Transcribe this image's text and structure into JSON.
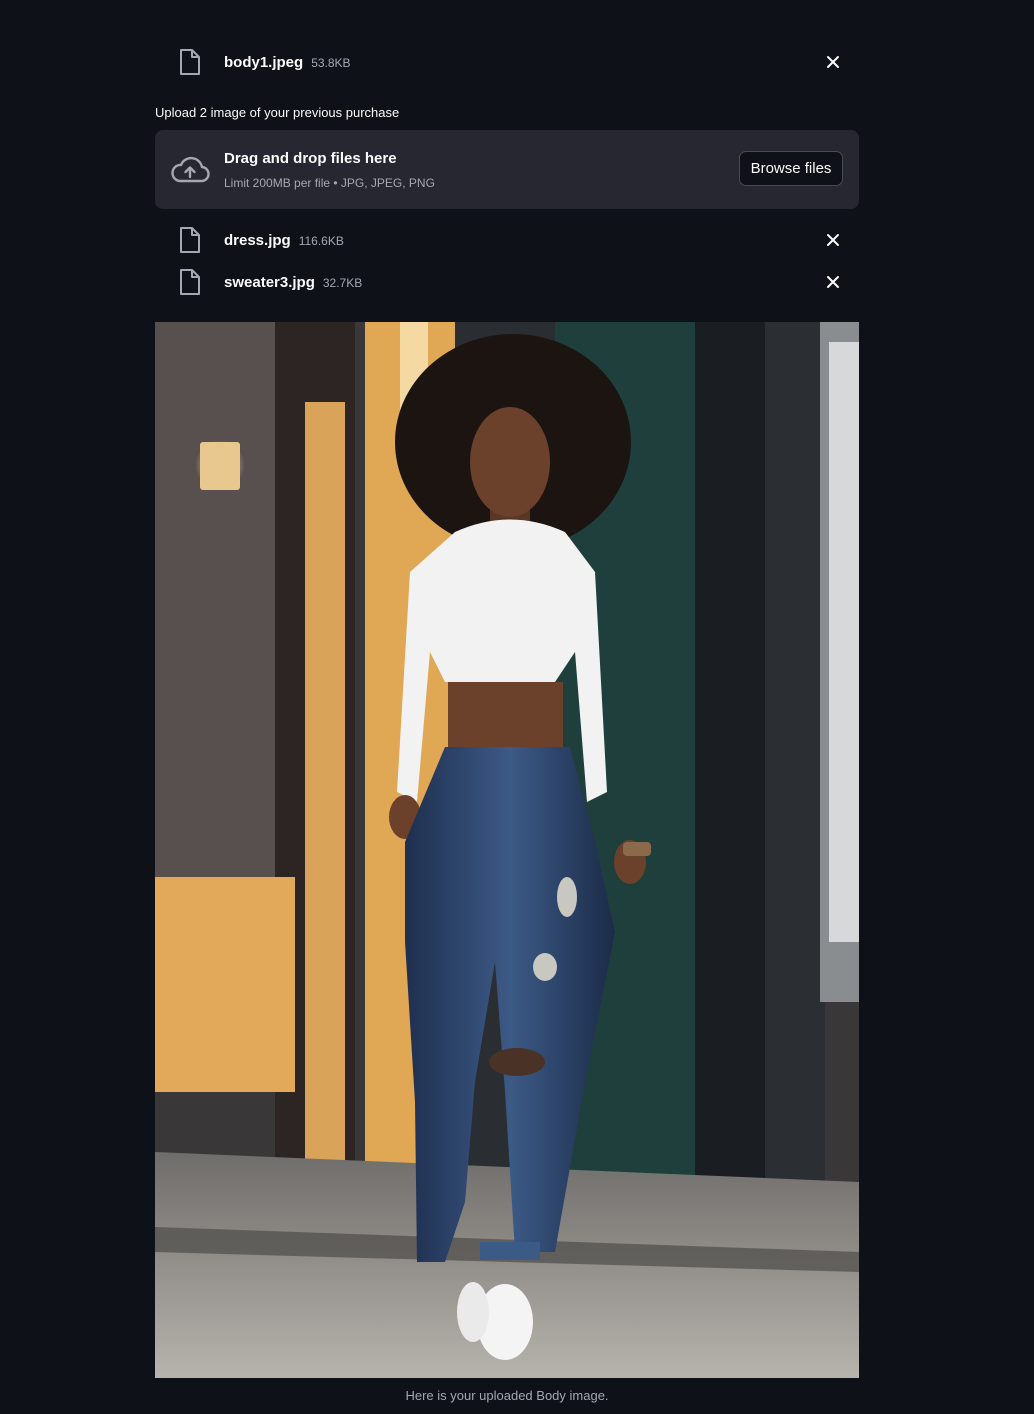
{
  "top_file": {
    "name": "body1.jpeg",
    "size": "53.8KB",
    "icon": "file-icon",
    "remove_icon": "close-icon"
  },
  "uploader": {
    "label": "Upload 2 image of your previous purchase",
    "icon": "cloud-upload-icon",
    "title": "Drag and drop files here",
    "subtitle": "Limit 200MB per file • JPG, JPEG, PNG",
    "button_label": "Browse files"
  },
  "uploaded_files": [
    {
      "name": "dress.jpg",
      "size": "116.6KB"
    },
    {
      "name": "sweater3.jpg",
      "size": "32.7KB"
    }
  ],
  "image": {
    "caption": "Here is your uploaded Body image."
  },
  "colors": {
    "background": "#0e1117",
    "dropzone": "#262730",
    "text": "#fafafa",
    "muted": "#a3a8b4"
  }
}
